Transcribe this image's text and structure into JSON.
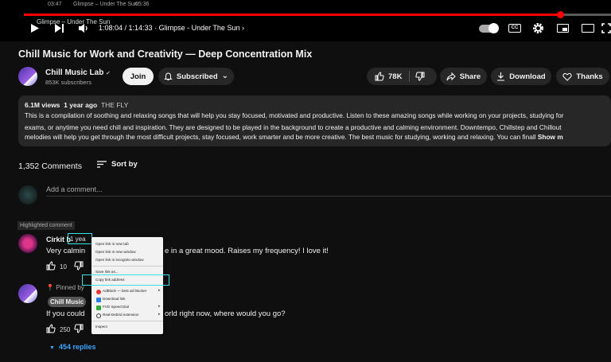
{
  "player": {
    "thumb_left": "03:47",
    "thumb_center": "Glimpse – Under The Sun",
    "thumb_right": "05:36",
    "chapter_tooltip": "Glimpse – Under The Sun",
    "time": "1:08:04 / 1:14:33",
    "chapter": "· Glimpse - Under The Sun",
    "chapter_chevron": "›",
    "cc_label": "CC",
    "progress_fraction": 0.913,
    "icons": [
      "play-icon",
      "next-icon",
      "volume-icon",
      "autoplay-toggle",
      "captions-icon",
      "settings-gear-icon",
      "miniplayer-icon",
      "theater-icon",
      "fullscreen-icon"
    ]
  },
  "video": {
    "title": "Chill Music for Work and Creativity — Deep Concentration Mix"
  },
  "channel": {
    "name": "Chill Music Lab",
    "verified": "✔",
    "subscribers": "853K subscribers",
    "join_label": "Join",
    "subscribed_label": "Subscribed",
    "bell": "🔔",
    "caret": "⌄"
  },
  "actions": {
    "like_count": "78K",
    "share_label": "Share",
    "download_label": "Download",
    "thanks_label": "Thanks"
  },
  "description": {
    "views": "6.1M views",
    "age": "1 year ago",
    "tag": "THE FLY",
    "line1": "This is a compilation of soothing and relaxing songs that will help you stay focused, motivated and productive. Listen to these amazing songs while working on your projects, studying for",
    "line2": "exams, or anytime you need chill and inspiration. They are designed to be played in the background to create a productive and calming environment. Downtempo, Chillstep and Chillout",
    "line3": "melodies will help you get through the most difficult projects, stay focused, work smarter and be more creative. The best music for studying, working and relaxing. You can finall",
    "show_more": "Show m"
  },
  "comments": {
    "count": "1,352 Comments",
    "sort_label": "Sort by",
    "add_placeholder": "Add a comment...",
    "highlighted_label": "Highlighted comment",
    "first": {
      "author": "Cirkit b",
      "time": "1 yea",
      "text_left": "Very calmin",
      "text_right": "e in a great mood. Raises my frequency! I love it!",
      "likes": "10"
    },
    "pinned": {
      "pinned_label": "Pinned by",
      "author_chip": "Chill Music",
      "text_left": "If you could",
      "text_right": "orld right now, where would you go?",
      "likes": "250",
      "replies": "454 replies"
    }
  },
  "context_menu": {
    "items": [
      "Open link in new tab",
      "Open link in new window",
      "Open link in incognito window",
      "Save link as...",
      "Copy link address",
      "AdBlock — best ad blocker",
      "Download link",
      "FVD Speed Dial",
      "Real-Debrid extension",
      "Inspect"
    ],
    "submenu_arrow": "▸"
  }
}
